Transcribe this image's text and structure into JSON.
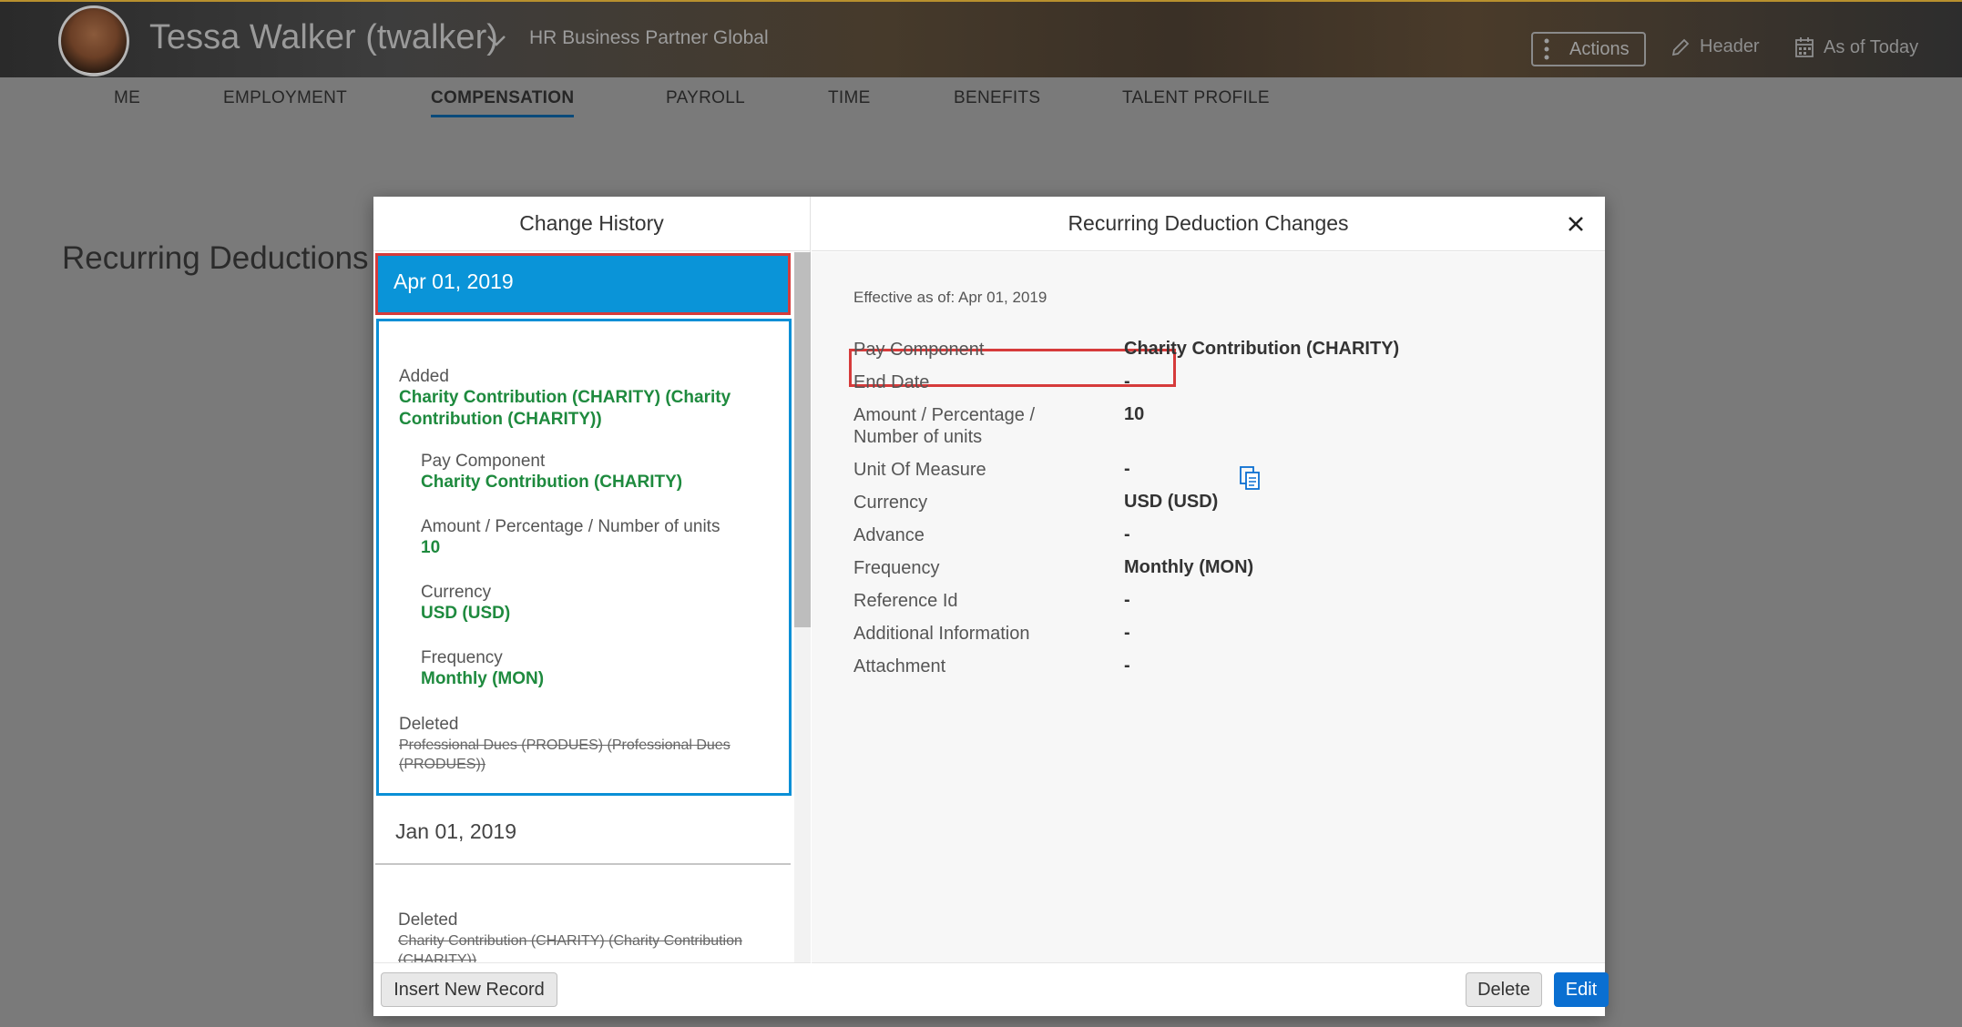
{
  "header": {
    "user_name": "Tessa Walker (twalker)",
    "user_role": "HR Business Partner Global",
    "actions_label": "Actions",
    "header_label": "Header",
    "as_of_label": "As of Today"
  },
  "tabs": [
    {
      "label": "ME"
    },
    {
      "label": "EMPLOYMENT"
    },
    {
      "label": "COMPENSATION"
    },
    {
      "label": "PAYROLL"
    },
    {
      "label": "TIME"
    },
    {
      "label": "BENEFITS"
    },
    {
      "label": "TALENT PROFILE"
    }
  ],
  "active_tab": "COMPENSATION",
  "background_section_title": "Recurring Deductions",
  "dialog": {
    "left_title": "Change History",
    "right_title": "Recurring Deduction Changes",
    "history": {
      "selected_date": "Apr 01, 2019",
      "added_label": "Added",
      "added_value": "Charity Contribution (CHARITY) (Charity Contribution (CHARITY))",
      "fields": [
        {
          "label": "Pay Component",
          "value": "Charity Contribution (CHARITY)"
        },
        {
          "label": "Amount / Percentage / Number of units",
          "value": "10"
        },
        {
          "label": "Currency",
          "value": "USD (USD)"
        },
        {
          "label": "Frequency",
          "value": "Monthly (MON)"
        }
      ],
      "deleted_label": "Deleted",
      "deleted_value": "Professional Dues (PRODUES) (Professional Dues (PRODUES))",
      "second_date": "Jan 01, 2019",
      "second_deleted_label": "Deleted",
      "second_deleted_value": "Charity Contribution (CHARITY) (Charity Contribution (CHARITY))"
    },
    "detail": {
      "effective_as_of": "Effective as of: Apr 01, 2019",
      "rows": [
        {
          "label": "Pay Component",
          "value": "Charity Contribution (CHARITY)"
        },
        {
          "label": "End Date",
          "value": "-"
        },
        {
          "label": "Amount / Percentage / Number of units",
          "value": "10"
        },
        {
          "label": "Unit Of Measure",
          "value": "-"
        },
        {
          "label": "Currency",
          "value": "USD (USD)"
        },
        {
          "label": "Advance",
          "value": "-"
        },
        {
          "label": "Frequency",
          "value": "Monthly (MON)"
        },
        {
          "label": "Reference Id",
          "value": "-"
        },
        {
          "label": "Additional Information",
          "value": "-"
        },
        {
          "label": "Attachment",
          "value": "-"
        }
      ]
    },
    "buttons": {
      "insert": "Insert New Record",
      "delete": "Delete",
      "edit": "Edit"
    }
  },
  "colors": {
    "accent": "#0a94d8",
    "primary_button": "#0a6fd1",
    "added_green": "#1e8a3e",
    "highlight_red": "#d63b3b"
  }
}
